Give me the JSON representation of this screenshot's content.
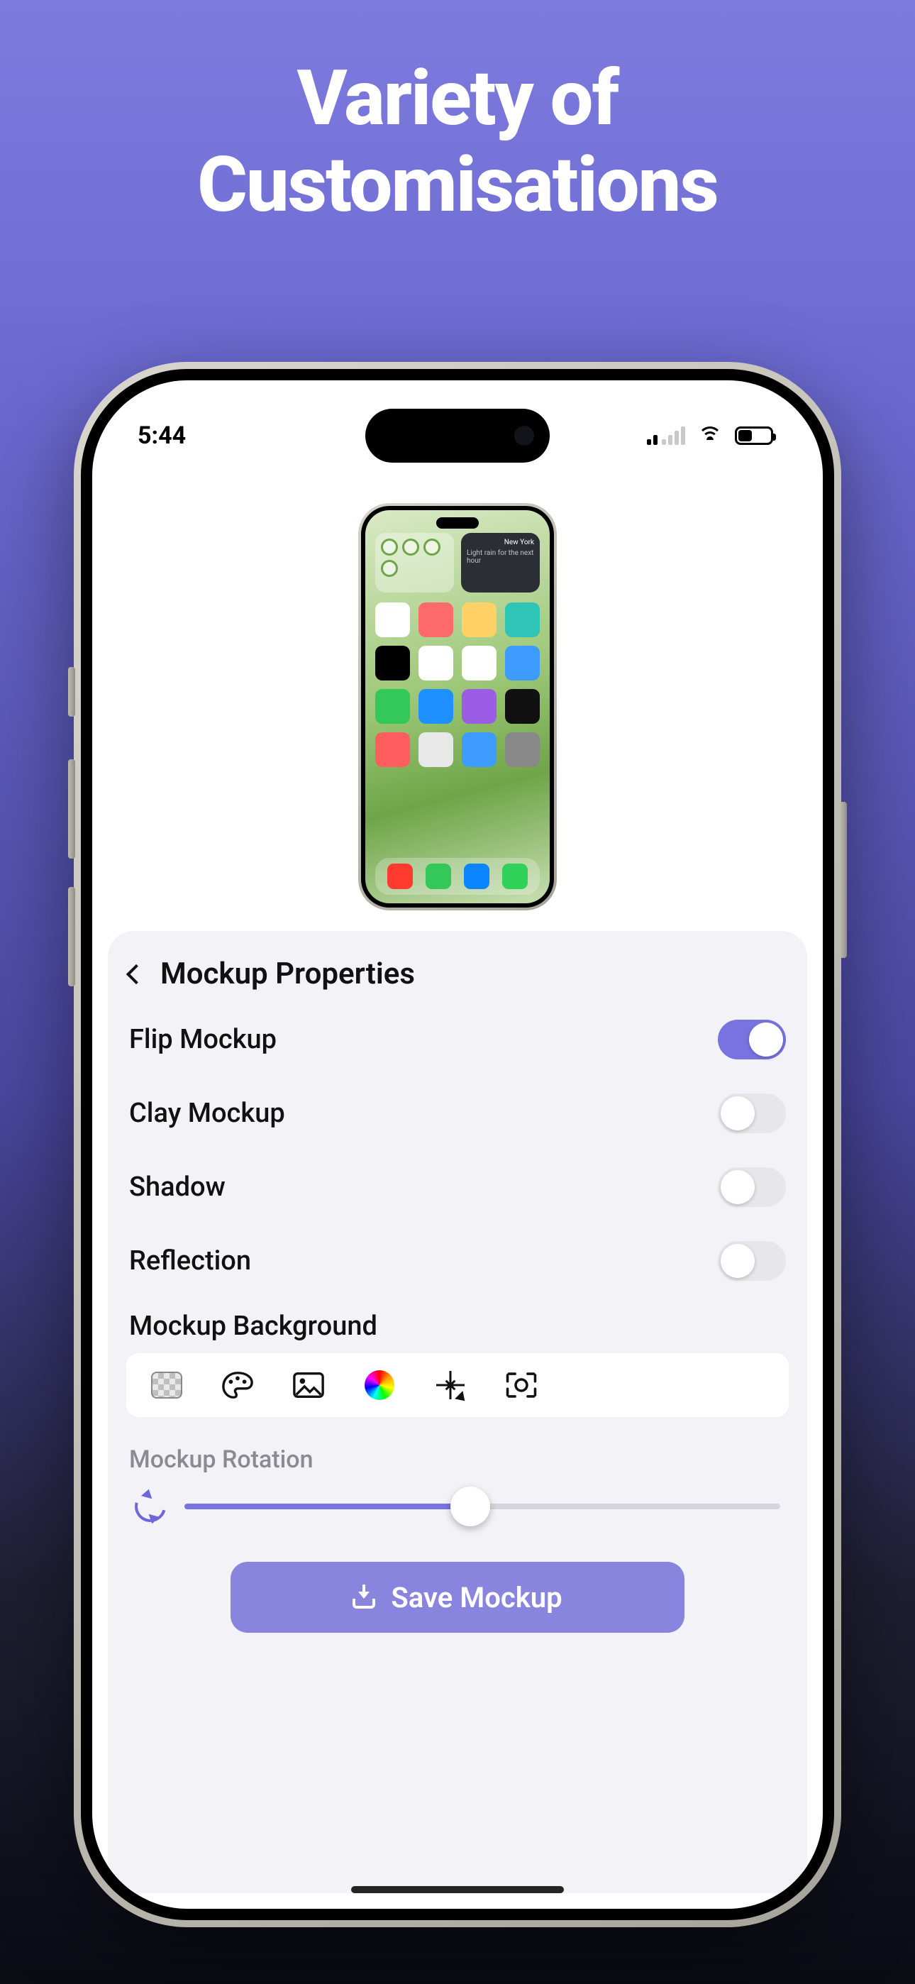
{
  "hero": {
    "line1": "Variety of",
    "line2": "Customisations"
  },
  "statusbar": {
    "time": "5:44"
  },
  "preview": {
    "widget_title": "New York",
    "widget_sub": "Light rain for the next hour"
  },
  "panel": {
    "title": "Mockup Properties",
    "rows": {
      "flip": {
        "label": "Flip Mockup",
        "on": true
      },
      "clay": {
        "label": "Clay Mockup",
        "on": false
      },
      "shadow": {
        "label": "Shadow",
        "on": false
      },
      "reflection": {
        "label": "Reflection",
        "on": false
      }
    },
    "background": {
      "label": "Mockup Background",
      "options": [
        "transparent",
        "palette",
        "image",
        "color-wheel",
        "magic",
        "camera"
      ]
    },
    "rotation": {
      "label": "Mockup Rotation",
      "value_pct": 48
    },
    "save_label": "Save Mockup"
  },
  "colors": {
    "accent": "#7873e0"
  }
}
